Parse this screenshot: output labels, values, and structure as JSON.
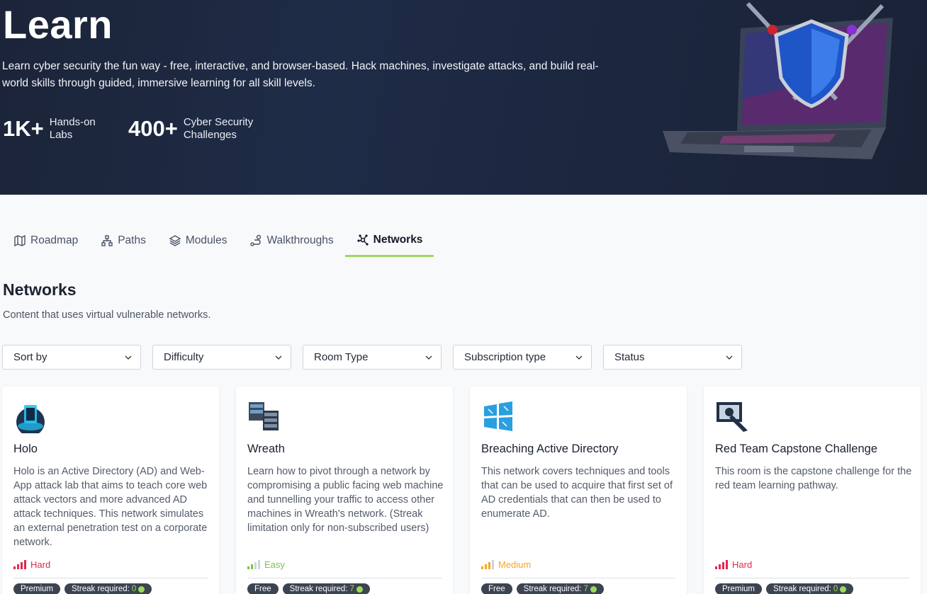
{
  "hero": {
    "title": "Learn",
    "description": "Learn cyber security the fun way - free, interactive, and browser-based. Hack machines, investigate attacks, and build real-world skills through guided, immersive learning for all skill levels.",
    "stats": [
      {
        "value": "1K+",
        "label": "Hands-on Labs"
      },
      {
        "value": "400+",
        "label": "Cyber Security Challenges"
      }
    ]
  },
  "tabs": [
    {
      "label": "Roadmap",
      "icon": "map-icon"
    },
    {
      "label": "Paths",
      "icon": "paths-icon"
    },
    {
      "label": "Modules",
      "icon": "layers-icon"
    },
    {
      "label": "Walkthroughs",
      "icon": "route-icon"
    },
    {
      "label": "Networks",
      "icon": "network-icon",
      "active": true
    }
  ],
  "section": {
    "title": "Networks",
    "subtitle": "Content that uses virtual vulnerable networks."
  },
  "filters": [
    {
      "label": "Sort by"
    },
    {
      "label": "Difficulty"
    },
    {
      "label": "Room Type"
    },
    {
      "label": "Subscription type"
    },
    {
      "label": "Status"
    }
  ],
  "colors": {
    "accent": "#9ed85b",
    "hard": "#e0284f",
    "easy": "#7cc24a",
    "medium": "#f5a623",
    "hero_bg": "#1c2740"
  },
  "cards": [
    {
      "title": "Holo",
      "icon": "holo-cube-icon",
      "description": "Holo is an Active Directory (AD) and Web-App attack lab that aims to teach core web attack vectors and more advanced AD attack techniques. This network simulates an external penetration test on a corporate network.",
      "difficulty": "Hard",
      "tags": [
        "Premium",
        "Streak required:"
      ],
      "streak": "0"
    },
    {
      "title": "Wreath",
      "icon": "server-stack-icon",
      "description": "Learn how to pivot through a network by compromising a public facing web machine and tunnelling your traffic to access other machines in Wreath's network. (Streak limitation only for non-subscribed users)",
      "difficulty": "Easy",
      "tags": [
        "Free",
        "Streak required:"
      ],
      "streak": "7"
    },
    {
      "title": "Breaching Active Directory",
      "icon": "windows-breach-icon",
      "description": "This network covers techniques and tools that can be used to acquire that first set of AD credentials that can then be used to enumerate AD.",
      "difficulty": "Medium",
      "tags": [
        "Free",
        "Streak required:"
      ],
      "streak": "7"
    },
    {
      "title": "Red Team Capstone Challenge",
      "icon": "capstone-monitor-icon",
      "description": "This room is the capstone challenge for the red team learning pathway.",
      "difficulty": "Hard",
      "tags": [
        "Premium",
        "Streak required:"
      ],
      "streak": "0"
    }
  ]
}
